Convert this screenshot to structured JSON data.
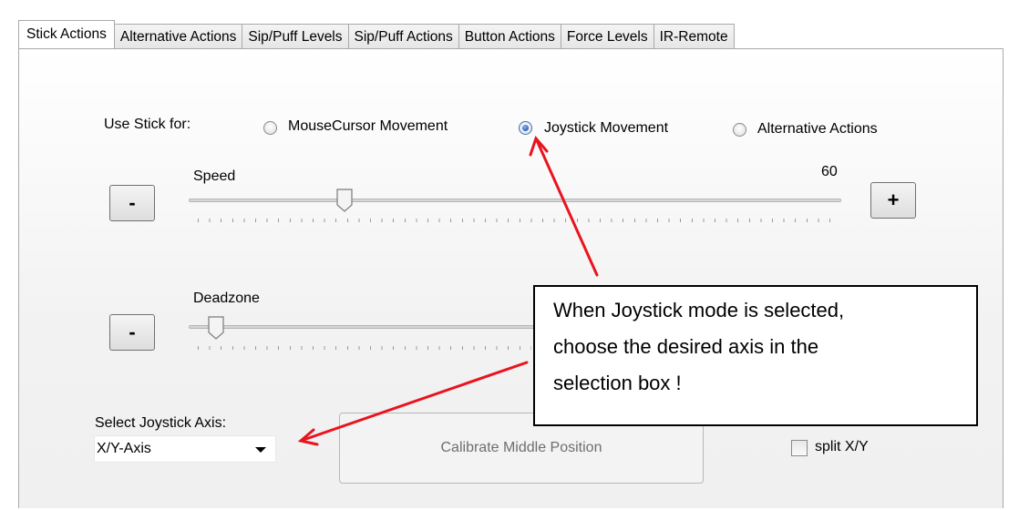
{
  "tabs": [
    "Stick Actions",
    "Alternative Actions",
    "Sip/Puff Levels",
    "Sip/Puff Actions",
    "Button Actions",
    "Force Levels",
    "IR-Remote"
  ],
  "active_tab": "Stick Actions",
  "use_stick": {
    "label": "Use Stick for:",
    "options": [
      "MouseCursor Movement",
      "Joystick Movement",
      "Alternative Actions"
    ],
    "selected": "Joystick Movement"
  },
  "speed": {
    "label": "Speed",
    "value": "60",
    "minus": "-",
    "plus": "+"
  },
  "deadzone": {
    "label": "Deadzone",
    "minus": "-"
  },
  "axis": {
    "label": "Select Joystick Axis:",
    "value": "X/Y-Axis"
  },
  "calibrate_label": "Calibrate Middle Position",
  "split_label": "split X/Y",
  "callout": {
    "lines": [
      "When Joystick mode is selected,",
      "choose the desired axis in the",
      "selection box !"
    ]
  },
  "colors": {
    "arrow": "#e8141e",
    "radio_selected": "#0b3f9c"
  }
}
